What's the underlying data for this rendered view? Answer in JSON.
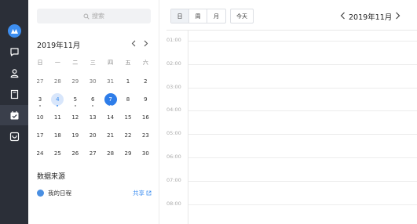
{
  "sidebar": {
    "items": [
      {
        "icon": "logo-icon"
      },
      {
        "icon": "chat-icon"
      },
      {
        "icon": "contacts-icon"
      },
      {
        "icon": "document-icon"
      },
      {
        "icon": "calendar-icon",
        "active": true
      },
      {
        "icon": "inbox-icon"
      }
    ]
  },
  "search": {
    "placeholder": "搜索"
  },
  "mini_calendar": {
    "title": "2019年11月",
    "weekdays": [
      "日",
      "一",
      "二",
      "三",
      "四",
      "五",
      "六"
    ],
    "weeks": [
      [
        "27",
        "28",
        "29",
        "30",
        "31",
        "1",
        "2"
      ],
      [
        "3",
        "4",
        "5",
        "6",
        "7",
        "8",
        "9"
      ],
      [
        "10",
        "11",
        "12",
        "13",
        "14",
        "15",
        "16"
      ],
      [
        "17",
        "18",
        "19",
        "20",
        "21",
        "22",
        "23"
      ],
      [
        "24",
        "25",
        "26",
        "27",
        "28",
        "29",
        "30"
      ]
    ],
    "today": "4",
    "selected": "7",
    "dotted_days": [
      "3",
      "4",
      "5",
      "6",
      "7"
    ]
  },
  "data_source": {
    "title": "数据来源",
    "items": [
      {
        "name": "我的日程",
        "color": "#4a8fe2",
        "share_label": "共享"
      }
    ]
  },
  "toolbar": {
    "views": [
      "日",
      "周",
      "月"
    ],
    "active_view": "日",
    "today_label": "今天",
    "month_title": "2019年11月"
  },
  "timeline": {
    "hours": [
      "01:00",
      "02:00",
      "03:00",
      "04:00",
      "05:00",
      "06:00",
      "07:00",
      "08:00"
    ]
  },
  "colors": {
    "accent": "#2e7de9",
    "rail": "#2b2f38"
  }
}
